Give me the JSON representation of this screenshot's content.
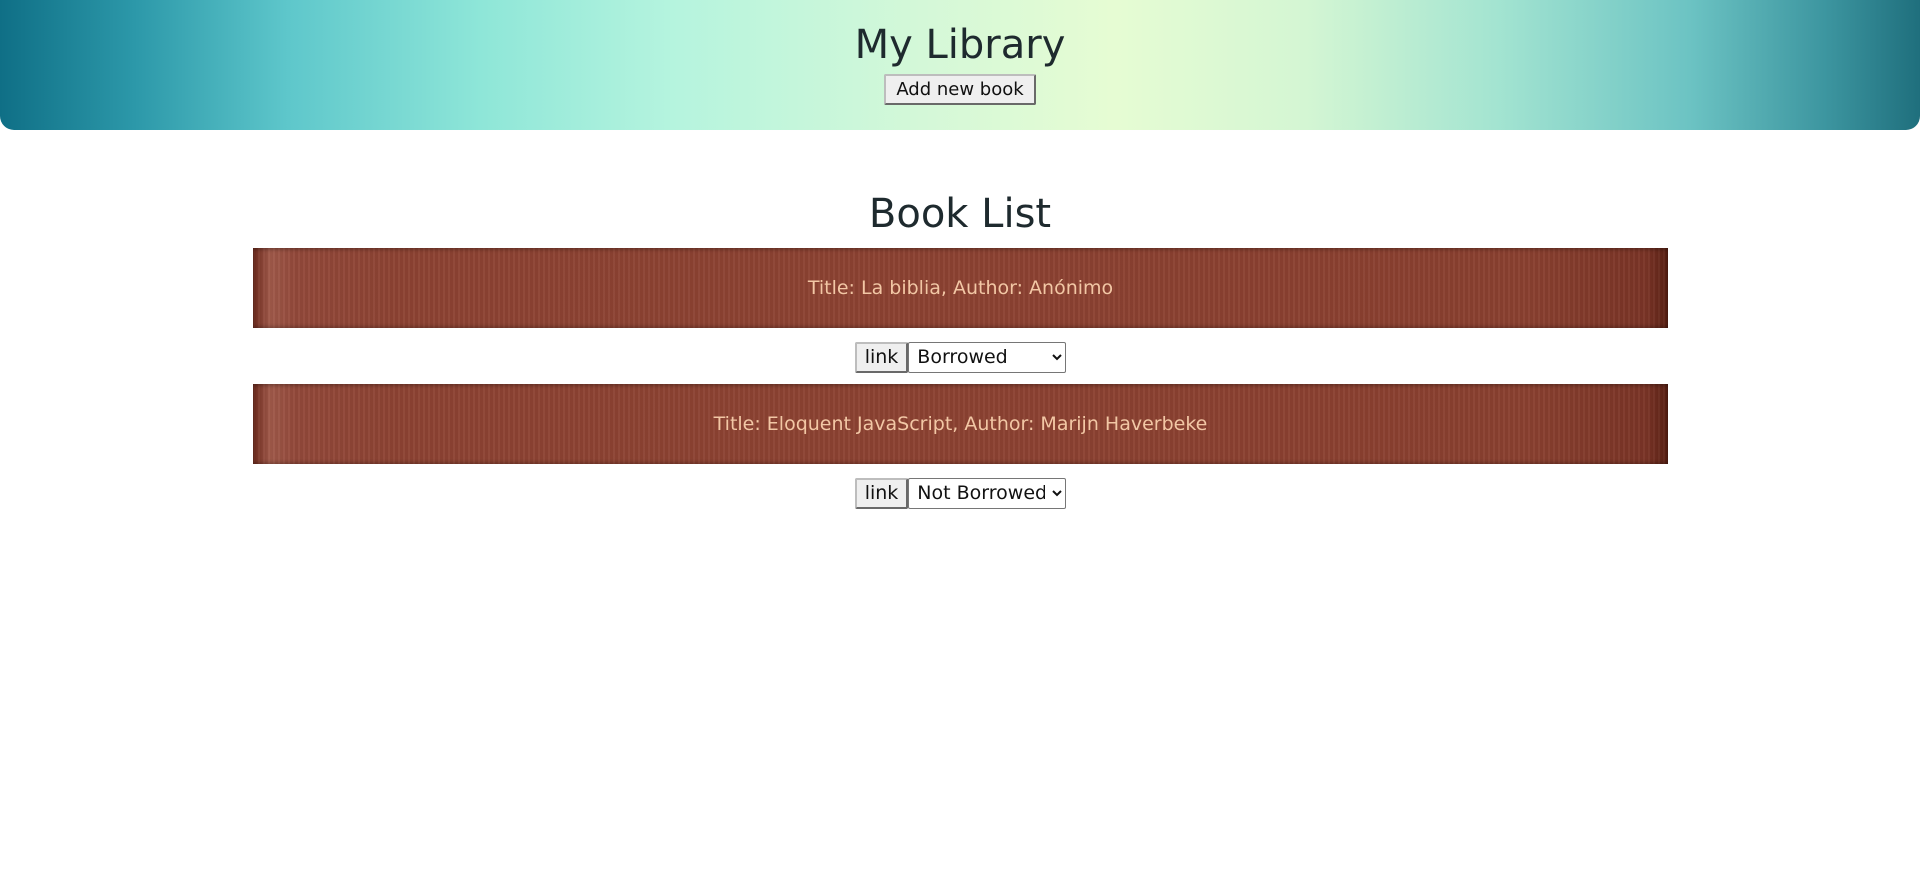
{
  "header": {
    "title": "My Library",
    "add_button_label": "Add new book"
  },
  "section": {
    "title": "Book List"
  },
  "books": [
    {
      "label": "Title: La biblia, Author: Anónimo",
      "link_label": "link",
      "status": "Borrowed"
    },
    {
      "label": "Title: Eloquent JavaScript, Author: Marijn Haverbeke",
      "link_label": "link",
      "status": "Not Borrowed"
    }
  ],
  "colors": {
    "banner_text": "#f2c7a5",
    "banner_background": "#8c4232",
    "header_gradient_edge": "#0f6f86",
    "header_gradient_center": "#e6fcd3"
  }
}
